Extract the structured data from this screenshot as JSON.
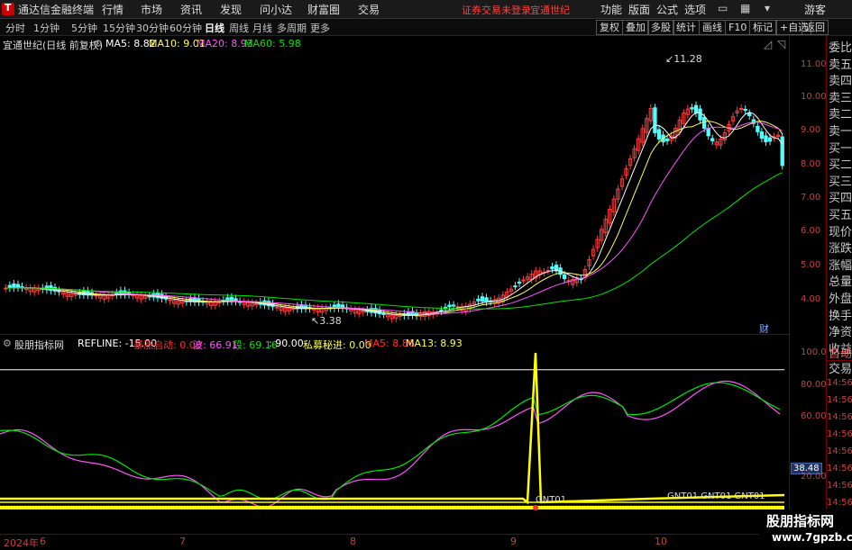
{
  "menubar": {
    "app_name": "通达信金融终端",
    "items": [
      "行情",
      "市场",
      "资讯",
      "发现",
      "问小达",
      "财富圈",
      "交易"
    ],
    "status": "证券交易未登录",
    "stock_name": "宜通世纪",
    "right_items": [
      "功能",
      "版面",
      "公式",
      "选项"
    ],
    "guest": "游客"
  },
  "periods": [
    "分时",
    "1分钟",
    "5分钟",
    "15分钟",
    "30分钟",
    "60分钟",
    "日线",
    "周线",
    "月线",
    "多周期",
    "更多"
  ],
  "active_period": "日线",
  "tools": [
    "复权",
    "叠加",
    "多股",
    "统计",
    "画线",
    "F10",
    "标记",
    "+自选",
    "返回"
  ],
  "main_info": {
    "title": "宜通世纪(日线 前复权)",
    "ma5": "MA5: 8.82",
    "ma10": "MA10: 9.01",
    "ma20": "MA20: 8.93",
    "ma60": "MA60: 5.98"
  },
  "main_axis": [
    "11.00",
    "10.00",
    "9.00",
    "8.00",
    "7.00",
    "6.00",
    "5.00",
    "4.00"
  ],
  "annotations": {
    "high": "11.28",
    "low": "3.38",
    "cai": "财"
  },
  "right_panel": [
    "委比",
    "卖五",
    "卖四",
    "卖三",
    "卖二",
    "卖一",
    "买一",
    "买二",
    "买三",
    "买四",
    "买五",
    "现价",
    "涨跌",
    "涨幅",
    "总量",
    "外盘",
    "换手",
    "净资",
    "收益",
    "自动",
    "交易"
  ],
  "sub_info": {
    "name": "股朋指标网",
    "refline": "REFLINE: -15.00",
    "zz_label": "暴涨启动: 0.00",
    "bo": "波: 66.91",
    "duan": "段: 69.16",
    "v90": ": 90.00",
    "sm": "私募秘进: 0.00",
    "ma5": "MA5: 8.86",
    "ma13": "MA13: 8.93"
  },
  "sub_axis": [
    "100.0",
    "80.00",
    "60.00",
    "40.00",
    "20.00"
  ],
  "sub_current": "38.48",
  "sub_right_ticks": [
    "14:56",
    "14:56",
    "14:56",
    "14:56",
    "14:56",
    "14:56",
    "14:56",
    "14:56"
  ],
  "sub_labels": {
    "gnt_a": "GNT01",
    "gnt_b": "GNT01 GNT01 GNT01"
  },
  "x_labels": [
    "2024年",
    "6",
    "7",
    "8",
    "9",
    "10"
  ],
  "watermark": {
    "line1": "股朋指标网",
    "line2": "www.7gpzb.com"
  },
  "colors": {
    "up": "#ff3a3a",
    "down": "#54fcfc",
    "ma5": "#ffffff",
    "ma10": "#ffff54",
    "ma20": "#ff54ff",
    "ma60": "#00e600",
    "axis": "#c84040",
    "yellow": "#ffff00"
  }
}
